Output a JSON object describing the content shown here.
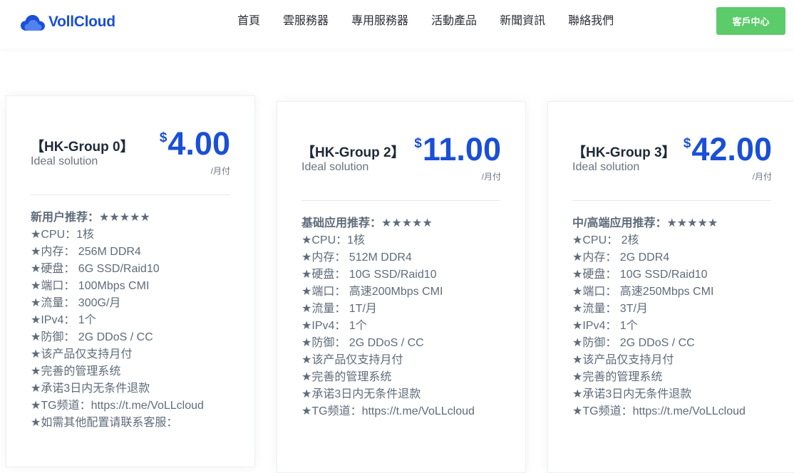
{
  "header": {
    "logo_text": "VollCloud",
    "nav": [
      "首頁",
      "雲服務器",
      "專用服務器",
      "活動產品",
      "新聞資訊",
      "聯絡我們"
    ],
    "client_button": "客戶中心",
    "brand_color": "#1a4fd6",
    "button_color": "#5ccb6a"
  },
  "plans": [
    {
      "name": "【HK-Group 0】",
      "tagline": "Ideal solution",
      "currency": "$",
      "price": "4.00",
      "period": "/月付",
      "features": [
        "新用户推荐：★★★★★",
        "★CPU：1核",
        "★内存： 256M DDR4",
        "★硬盘： 6G SSD/Raid10",
        "★端口： 100Mbps CMI",
        "★流量： 300G/月",
        "★IPv4： 1个",
        "★防御： 2G DDoS / CC",
        "★该产品仅支持月付",
        "★完善的管理系统",
        "★承诺3日内无条件退款",
        "★TG频道：https://t.me/VoLLcloud",
        "★如需其他配置请联系客服："
      ]
    },
    {
      "name": "【HK-Group 2】",
      "tagline": "Ideal solution",
      "currency": "$",
      "price": "11.00",
      "period": "/月付",
      "features": [
        "基础应用推荐：★★★★★",
        "★CPU：1核",
        "★内存： 512M DDR4",
        "★硬盘： 10G SSD/Raid10",
        "★端口： 高速200Mbps CMI",
        "★流量： 1T/月",
        "★IPv4： 1个",
        "★防御： 2G DDoS / CC",
        "★该产品仅支持月付",
        "★完善的管理系统",
        "★承诺3日内无条件退款",
        "★TG频道：https://t.me/VoLLcloud"
      ]
    },
    {
      "name": "【HK-Group 3】",
      "tagline": "Ideal solution",
      "currency": "$",
      "price": "42.00",
      "period": "/月付",
      "features": [
        "中/高端应用推荐：★★★★★",
        "★CPU： 2核",
        "★内存： 2G DDR4",
        "★硬盘： 10G SSD/Raid10",
        "★端口： 高速250Mbps CMI",
        "★流量： 3T/月",
        "★IPv4： 1个",
        "★防御： 2G DDoS / CC",
        "★该产品仅支持月付",
        "★完善的管理系统",
        "★承诺3日内无条件退款",
        "★TG频道：https://t.me/VoLLcloud"
      ]
    }
  ]
}
